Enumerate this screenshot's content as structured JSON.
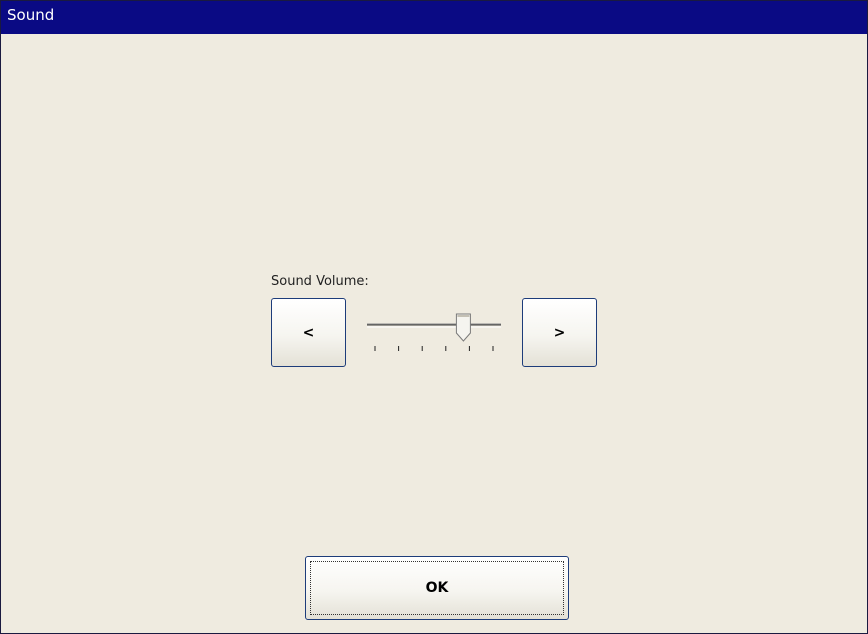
{
  "window": {
    "title": "Sound"
  },
  "volume": {
    "label": "Sound Volume:",
    "decrease_label": "<",
    "increase_label": ">",
    "slider": {
      "min": 0,
      "max": 5,
      "value": 4,
      "tick_count": 6
    }
  },
  "footer": {
    "ok_label": "OK"
  },
  "colors": {
    "titlebar": "#0a0a84",
    "background": "#efebe0",
    "button_border": "#1d3c7a"
  }
}
